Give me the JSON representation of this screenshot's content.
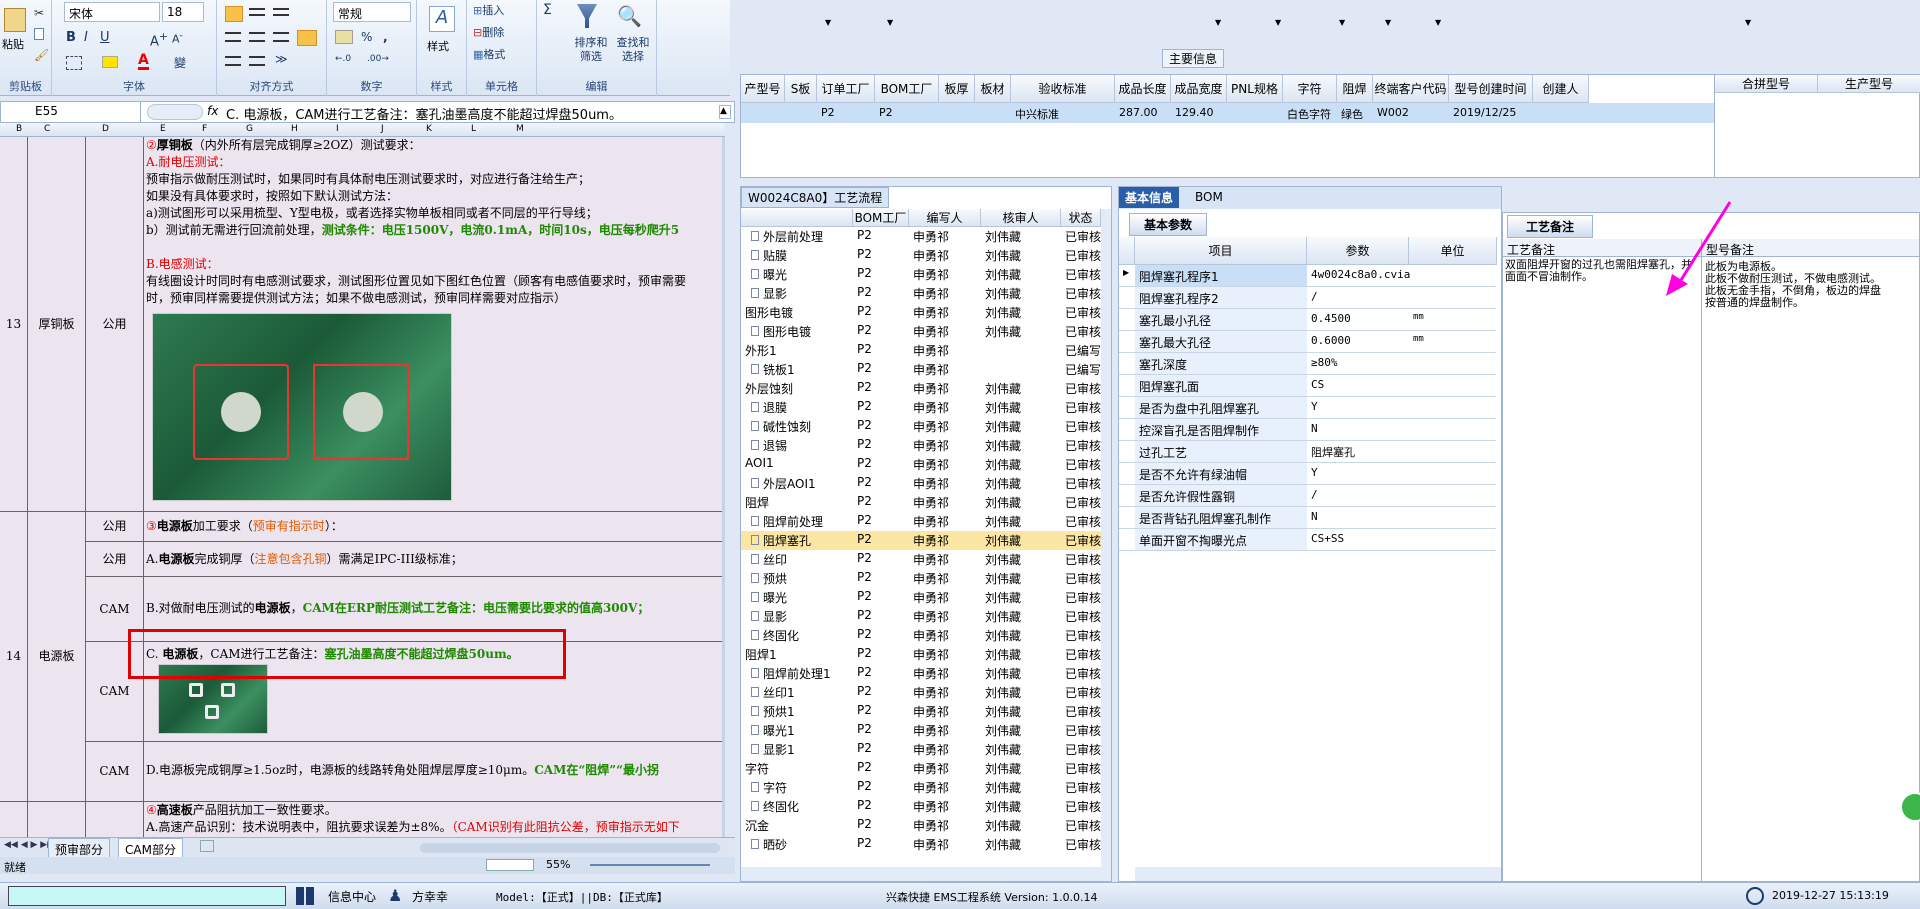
{
  "excel": {
    "font_name": "宋体",
    "font_size": "18",
    "number_format": "常规",
    "labels": {
      "paste": "粘贴",
      "clipboard": "剪贴板",
      "font": "字体",
      "align": "对齐方式",
      "number": "数字",
      "styles": "样式",
      "cells": "单元格",
      "edit": "编辑",
      "insert": "插入",
      "delete": "删除",
      "format": "格式",
      "sort": "排序和筛选",
      "find": "查找和选择",
      "percent": "%",
      "comma": ",",
      "sigma": "Σ"
    },
    "namebox": "E55",
    "fx": "fx",
    "formula": "C.  电源板，CAM进行工艺备注：塞孔油墨高度不能超过焊盘50um。",
    "colheaders": [
      "B",
      "C",
      "D",
      "E",
      "F",
      "G",
      "H",
      "I",
      "J",
      "K",
      "L",
      "M"
    ],
    "rows": {
      "r13_num": "13",
      "r13_type": "厚铜板",
      "r13_scope": "公用",
      "r13_lines": [
        {
          "a": "②",
          "b": "厚铜板",
          "c": "（内外所有层完成铜厚≥2OZ）测试要求："
        },
        {
          "text": "A.耐电压测试："
        },
        {
          "text": "预审指示做耐压测试时，如果同时有具体耐电压测试要求时，对应进行备注给生产；"
        },
        {
          "text": "如果没有具体要求时，按照如下默认测试方法："
        },
        {
          "text": "a)测试图形可以采用梳型、Y型电极，或者选择实物单板相同或者不同层的平行导线；"
        },
        {
          "a": "b）测试前无需进行回流前处理，",
          "b": "测试条件：电压1500V，电流0.1mA，时间10s，电压每秒爬升5"
        },
        {
          "text": "B.电感测试："
        },
        {
          "text": "有线圈设计时同时有电感测试要求，测试图形位置见如下图红色位置（顾客有电感值要求时，预审需要"
        },
        {
          "text": "时，预审同样需要提供测试方法；如果不做电感测试，预审同样需要对应指示）"
        }
      ],
      "r14_num": "14",
      "r14_type": "电源板",
      "r14_scopes": [
        "公用",
        "公用",
        "CAM",
        "CAM",
        "CAM"
      ],
      "r14_a": {
        "a": "③",
        "b": "电源板",
        "c": "加工要求（",
        "d": "预审有指示时",
        "e": "）："
      },
      "r14_b": {
        "a": "A.",
        "b": "电源板",
        "c": "完成铜厚（",
        "d": "注意包含孔铜",
        "e": "）需满足IPC-III级标准；"
      },
      "r14_c": {
        "a": "B.对做耐电压测试的",
        "b": "电源板",
        "c": "，",
        "d": "CAM在ERP耐压测试工艺备注：电压需要比要求的值高300V；"
      },
      "r14_d": {
        "a": "C. ",
        "b": "电源板",
        "c": "，CAM进行工艺备注：",
        "d": "塞孔油墨高度不能超过焊盘50um。"
      },
      "r14_e": {
        "a": "D.电源板完成铜厚≥1.5oz时，电源板的线路转角处阻焊层厚度≥10μm。",
        "b": "CAM在“阻焊”“最小拐"
      },
      "r15_a": {
        "a": "④",
        "b": "高速板",
        "c": "产品阻抗加工一致性要求。"
      },
      "r15_b": {
        "a": "A.高速产品识别：技术说明表中，阻抗要求误差为±8%。",
        "b": "（CAM识别有此阻抗公差，预审指示无如下"
      }
    },
    "tabs": [
      "预审部分",
      "CAM部分"
    ],
    "zoom": "55%",
    "status_left": "就绪"
  },
  "ems": {
    "main_info": "主要信息",
    "main_cols": [
      "产型号",
      "S板",
      "订单工厂",
      "BOM工厂",
      "板厚",
      "板材",
      "验收标准",
      "成品长度",
      "成品宽度",
      "PNL规格",
      "字符",
      "阻焊",
      "终端客户代码",
      "型号创建时间",
      "创建人"
    ],
    "main_row": [
      "",
      "",
      "P2",
      "P2",
      "",
      "",
      "中兴标准",
      "287.00",
      "129.40",
      "",
      "白色字符",
      "绿色",
      "W002",
      "2019/12/25",
      ""
    ],
    "right_cols": [
      "合拼型号",
      "生产型号"
    ],
    "process_tab": "W0024C8A0】工艺流程",
    "process_cols": [
      "",
      "BOM工厂",
      "编写人",
      "核审人",
      "状态"
    ],
    "process_rows": [
      [
        "外层前处理",
        "P2",
        "申勇祁",
        "刘伟藏",
        "已审核"
      ],
      [
        "贴膜",
        "P2",
        "申勇祁",
        "刘伟藏",
        "已审核"
      ],
      [
        "曝光",
        "P2",
        "申勇祁",
        "刘伟藏",
        "已审核"
      ],
      [
        "显影",
        "P2",
        "申勇祁",
        "刘伟藏",
        "已审核"
      ],
      [
        "图形电镀",
        "P2",
        "申勇祁",
        "刘伟藏",
        "已审核"
      ],
      [
        "图形电镀",
        "P2",
        "申勇祁",
        "刘伟藏",
        "已审核"
      ],
      [
        "外形1",
        "P2",
        "申勇祁",
        "",
        "已编写"
      ],
      [
        "铣板1",
        "P2",
        "申勇祁",
        "",
        "已编写"
      ],
      [
        "外层蚀刻",
        "P2",
        "申勇祁",
        "刘伟藏",
        "已审核"
      ],
      [
        "退膜",
        "P2",
        "申勇祁",
        "刘伟藏",
        "已审核"
      ],
      [
        "碱性蚀刻",
        "P2",
        "申勇祁",
        "刘伟藏",
        "已审核"
      ],
      [
        "退锡",
        "P2",
        "申勇祁",
        "刘伟藏",
        "已审核"
      ],
      [
        "AOI1",
        "P2",
        "申勇祁",
        "刘伟藏",
        "已审核"
      ],
      [
        "外层AOI1",
        "P2",
        "申勇祁",
        "刘伟藏",
        "已审核"
      ],
      [
        "阻焊",
        "P2",
        "申勇祁",
        "刘伟藏",
        "已审核"
      ],
      [
        "阻焊前处理",
        "P2",
        "申勇祁",
        "刘伟藏",
        "已审核"
      ],
      [
        "阻焊塞孔",
        "P2",
        "申勇祁",
        "刘伟藏",
        "已审核"
      ],
      [
        "丝印",
        "P2",
        "申勇祁",
        "刘伟藏",
        "已审核"
      ],
      [
        "预烘",
        "P2",
        "申勇祁",
        "刘伟藏",
        "已审核"
      ],
      [
        "曝光",
        "P2",
        "申勇祁",
        "刘伟藏",
        "已审核"
      ],
      [
        "显影",
        "P2",
        "申勇祁",
        "刘伟藏",
        "已审核"
      ],
      [
        "终固化",
        "P2",
        "申勇祁",
        "刘伟藏",
        "已审核"
      ],
      [
        "阻焊1",
        "P2",
        "申勇祁",
        "刘伟藏",
        "已审核"
      ],
      [
        "阻焊前处理1",
        "P2",
        "申勇祁",
        "刘伟藏",
        "已审核"
      ],
      [
        "丝印1",
        "P2",
        "申勇祁",
        "刘伟藏",
        "已审核"
      ],
      [
        "预烘1",
        "P2",
        "申勇祁",
        "刘伟藏",
        "已审核"
      ],
      [
        "曝光1",
        "P2",
        "申勇祁",
        "刘伟藏",
        "已审核"
      ],
      [
        "显影1",
        "P2",
        "申勇祁",
        "刘伟藏",
        "已审核"
      ],
      [
        "字符",
        "P2",
        "申勇祁",
        "刘伟藏",
        "已审核"
      ],
      [
        "字符",
        "P2",
        "申勇祁",
        "刘伟藏",
        "已审核"
      ],
      [
        "终固化",
        "P2",
        "申勇祁",
        "刘伟藏",
        "已审核"
      ],
      [
        "沉金",
        "P2",
        "申勇祁",
        "刘伟藏",
        "已审核"
      ],
      [
        "晒砂",
        "P2",
        "申勇祁",
        "刘伟藏",
        "已审核"
      ]
    ],
    "basic_tabs": [
      "基本信息",
      "BOM"
    ],
    "basic_params": "基本参数",
    "param_cols": [
      "项目",
      "参数",
      "单位"
    ],
    "params": [
      [
        "阻焊塞孔程序1",
        "4w0024c8a0.cvia",
        ""
      ],
      [
        "阻焊塞孔程序2",
        "/",
        ""
      ],
      [
        "塞孔最小孔径",
        "0.4500",
        "mm"
      ],
      [
        "塞孔最大孔径",
        "0.6000",
        "mm"
      ],
      [
        "塞孔深度",
        "≥80%",
        ""
      ],
      [
        "阻焊塞孔面",
        "CS",
        ""
      ],
      [
        "是否为盘中孔阻焊塞孔",
        "Y",
        ""
      ],
      [
        "控深盲孔是否阻焊制作",
        "N",
        ""
      ],
      [
        "过孔工艺",
        "阻焊塞孔",
        ""
      ],
      [
        "是否不允许有绿油帽",
        "Y",
        ""
      ],
      [
        "是否允许假性露铜",
        "/",
        ""
      ],
      [
        "是否背钻孔阻焊塞孔制作",
        "N",
        ""
      ],
      [
        "单面开窗不掏曝光点",
        "CS+SS",
        ""
      ]
    ],
    "remark_tab": "工艺备注",
    "remark_col1": "工艺备注",
    "remark_col2": "型号备注",
    "remark_text": "双面阻焊开窗的过孔也需阻焊塞孔，并面面不冒油制作。",
    "model_remark": [
      "此板为电源板。",
      "此板不做耐压测试，不做电感测试。",
      "此板无金手指，不倒角，板边的焊盘",
      "按普通的焊盘制作。"
    ],
    "accent_pink": "#ff00e0",
    "highlight_red": "#e00000"
  },
  "taskbar": {
    "info_center": "信息中心",
    "user": "方幸幸",
    "model_db": "Model:【正式】||DB:【正式库】",
    "system": "兴森快捷 EMS工程系统 Version: 1.0.0.14",
    "datetime": "2019-12-27 15:13:19"
  }
}
